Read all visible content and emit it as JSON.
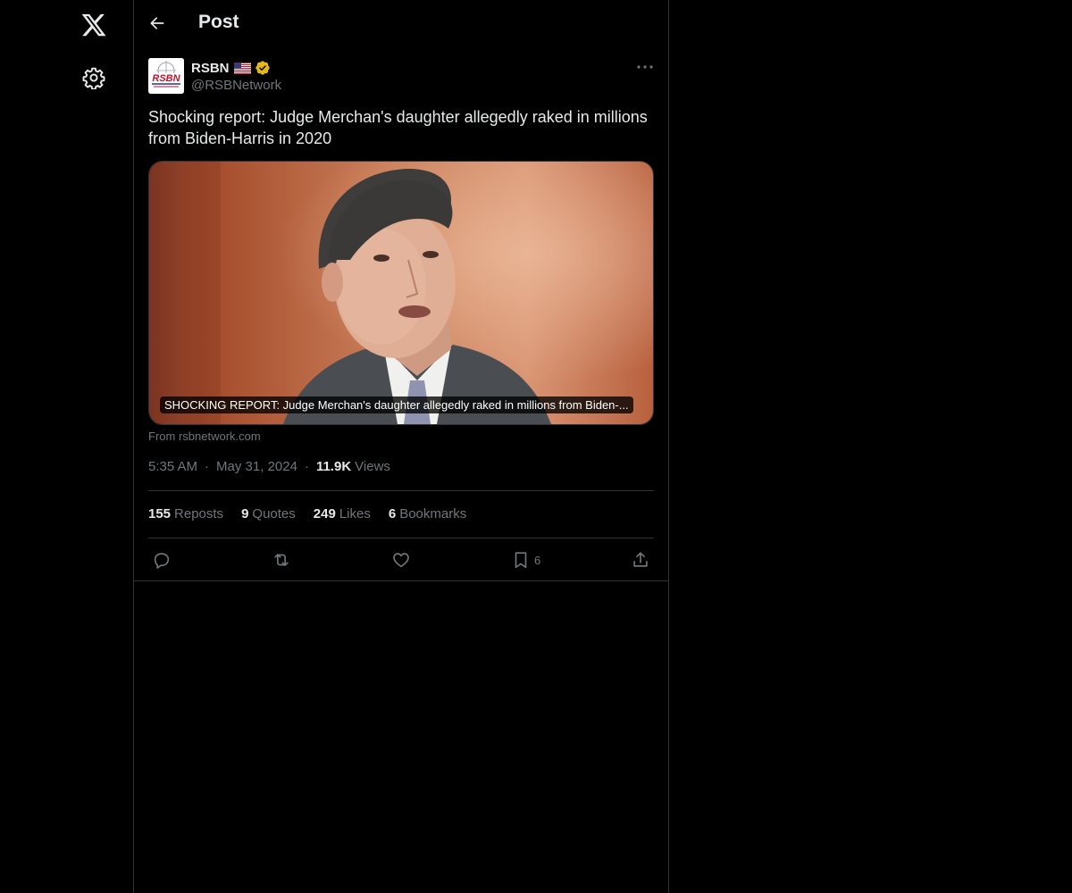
{
  "nav": {
    "logo_icon": "x-logo-icon",
    "settings_icon": "gear-icon"
  },
  "header": {
    "back_icon": "arrow-left-icon",
    "title": "Post"
  },
  "post": {
    "author": {
      "name": "RSBN",
      "flag": "🇺🇸",
      "verified": true,
      "handle": "@RSBNetwork",
      "avatar_text": "RSBN"
    },
    "text": "Shocking report: Judge Merchan's daughter allegedly raked in millions from Biden-Harris in 2020",
    "card": {
      "caption": "SHOCKING REPORT: Judge Merchan's daughter allegedly raked in millions from Biden-...",
      "source": "From rsbnetwork.com"
    },
    "time": "5:35 AM",
    "date": "May 31, 2024",
    "views_count": "11.9K",
    "views_label": "Views",
    "stats": {
      "reposts_count": "155",
      "reposts_label": "Reposts",
      "quotes_count": "9",
      "quotes_label": "Quotes",
      "likes_count": "249",
      "likes_label": "Likes",
      "bookmarks_count": "6",
      "bookmarks_label": "Bookmarks"
    },
    "actions": {
      "bookmark_count": "6"
    }
  },
  "colors": {
    "background": "#000000",
    "text_primary": "#e7e9ea",
    "text_secondary": "#71767b",
    "border": "#2f3336",
    "verified_gold": "#e2b719"
  }
}
